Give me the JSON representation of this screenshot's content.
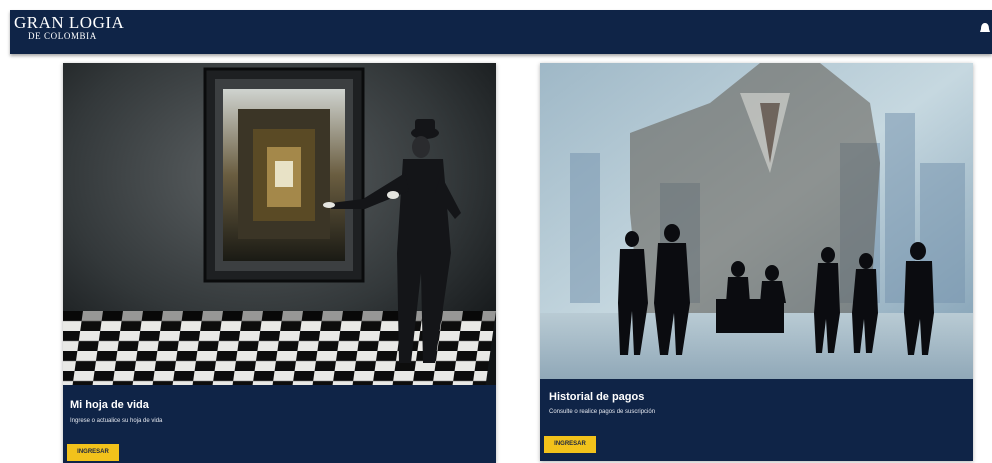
{
  "header": {
    "brand_title": "GRAN LOGIA",
    "brand_subtitle": "DE COLOMBIA",
    "bg_color": "#0f2447",
    "right_icon": "notification-icon"
  },
  "cards": [
    {
      "title": "Mi hoja de vida",
      "description": "Ingrese o actualice su hoja de vida",
      "button_label": "INGRESAR",
      "image": "magician-pointing-at-framed-corridor-image"
    },
    {
      "title": "Historial de pagos",
      "description": "Consulte o realice pagos de suscripción",
      "button_label": "INGRESAR",
      "image": "business-silhouettes-cityscape-image"
    }
  ],
  "colors": {
    "card_bg": "#0f2447",
    "button_bg": "#f2c21b"
  }
}
